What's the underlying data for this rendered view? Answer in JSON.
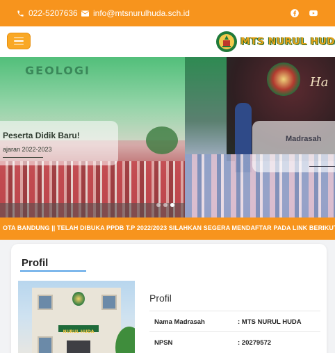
{
  "topbar": {
    "phone": "022-5207636",
    "email": "info@mtsnurulhuda.sch.id",
    "phone_icon": "phone-icon",
    "email_icon": "envelope-icon",
    "social_icons": [
      "facebook-icon",
      "youtube-icon"
    ]
  },
  "navbar": {
    "brand": "MTS NURUL HUDA",
    "menu_icon": "hamburger-icon"
  },
  "slider": {
    "watermark": "GEOLOGI",
    "slides": [
      {
        "title": "Peserta Didik Baru!",
        "subtitle": "ajaran 2022-2023"
      },
      {
        "title": "Madrasah",
        "subtitle": ""
      }
    ],
    "photo_text": "Ha",
    "dot_count": 3,
    "active_dot": 2
  },
  "ticker": {
    "text": "OTA BANDUNG || TELAH DIBUKA PPDB T.P 2022/2023 SILAHKAN SEGERA MENDAFTAR PADA LINK BERIKUT :"
  },
  "profile": {
    "section_title": "Profil",
    "detail_title": "Profil",
    "photo_sign": "NURUL HUDA",
    "rows": [
      {
        "label": "Nama Madrasah",
        "value": ": MTS NURUL HUDA"
      },
      {
        "label": "NPSN",
        "value": ": 20279572"
      }
    ]
  },
  "colors": {
    "accent": "#f7941d",
    "brand_text": "#e5a21a",
    "brand_outline": "#1d6b2e",
    "underline": "#5aa4e6"
  }
}
